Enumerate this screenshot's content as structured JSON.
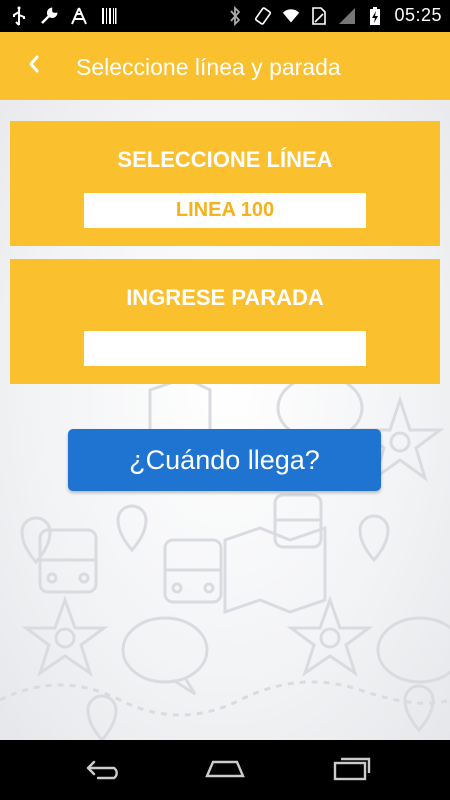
{
  "status_bar": {
    "time": "05:25",
    "left_icons": [
      "usb-icon",
      "wrench-icon",
      "signal-tower-icon",
      "barcode-icon"
    ],
    "right_icons": [
      "bluetooth-icon",
      "rotate-icon",
      "wifi-icon",
      "no-sim-icon",
      "cell-signal-icon",
      "battery-charging-icon"
    ]
  },
  "app_bar": {
    "title": "Seleccione línea y parada",
    "back_icon": "chevron-left-icon",
    "color": "#fbc02d"
  },
  "line_card": {
    "title": "SELECCIONE LÍNEA",
    "value": "LINEA 100"
  },
  "stop_card": {
    "title": "INGRESE PARADA",
    "value": ""
  },
  "cta": {
    "label": "¿Cuándo llega?",
    "color": "#1e74d0"
  },
  "background": {
    "watermark_icons": [
      "bus-icon",
      "map-pin-icon",
      "star-parking-icon",
      "speech-bubble-icon",
      "map-icon"
    ]
  },
  "nav_bar": {
    "buttons": [
      "back-nav-icon",
      "home-nav-icon",
      "recents-nav-icon"
    ]
  }
}
